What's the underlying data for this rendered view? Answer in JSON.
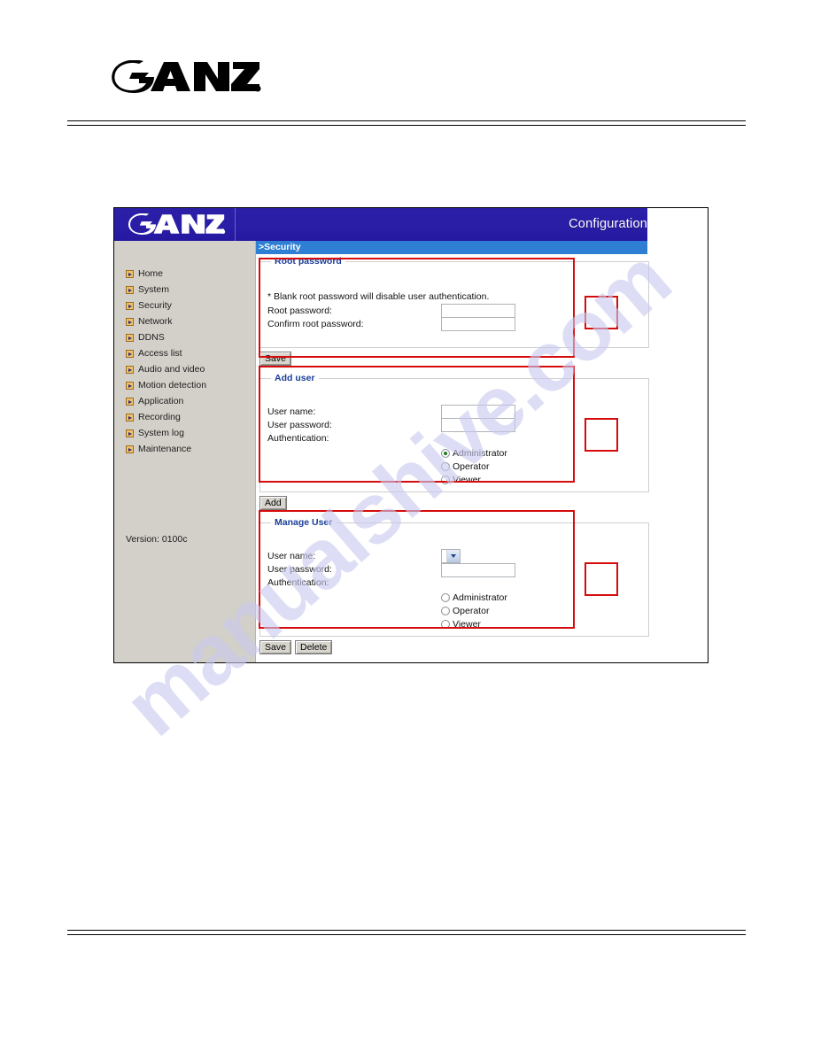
{
  "document": {
    "brand_logo": "ganz-logo",
    "watermark_text": "manualshive.com",
    "rule_top": "",
    "rule_bottom": ""
  },
  "ui": {
    "logo": "ganz-logo",
    "header_right_label": "Configuration",
    "breadcrumb": ">Security",
    "version_text": "Version: 0100c",
    "sidebar": {
      "items": [
        {
          "label": "Home",
          "icon": "arrow-bullet-icon"
        },
        {
          "label": "System",
          "icon": "arrow-bullet-icon"
        },
        {
          "label": "Security",
          "icon": "arrow-bullet-icon"
        },
        {
          "label": "Network",
          "icon": "arrow-bullet-icon"
        },
        {
          "label": "DDNS",
          "icon": "arrow-bullet-icon"
        },
        {
          "label": "Access list",
          "icon": "arrow-bullet-icon"
        },
        {
          "label": "Audio and video",
          "icon": "arrow-bullet-icon"
        },
        {
          "label": "Motion detection",
          "icon": "arrow-bullet-icon"
        },
        {
          "label": "Application",
          "icon": "arrow-bullet-icon"
        },
        {
          "label": "Recording",
          "icon": "arrow-bullet-icon"
        },
        {
          "label": "System log",
          "icon": "arrow-bullet-icon"
        },
        {
          "label": "Maintenance",
          "icon": "arrow-bullet-icon"
        }
      ]
    },
    "panels": {
      "root_password": {
        "legend": "Root password",
        "note": "* Blank root password will disable user authentication.",
        "label_password": "Root password:",
        "label_confirm": "Confirm root password:",
        "value_password": "",
        "value_confirm": "",
        "save_label": "Save"
      },
      "add_user": {
        "legend": "Add user",
        "label_user": "User name:",
        "label_password": "User password:",
        "label_auth": "Authentication:",
        "value_user": "",
        "value_password": "",
        "radios": [
          {
            "label": "Administrator",
            "checked": true
          },
          {
            "label": "Operator",
            "checked": false
          },
          {
            "label": "Viewer",
            "checked": false
          }
        ],
        "add_label": "Add"
      },
      "manage_user": {
        "legend": "Manage User",
        "label_user": "User name:",
        "label_password": "User password:",
        "label_auth": "Authentication:",
        "selected_user": "",
        "value_password": "",
        "radios": [
          {
            "label": "Administrator",
            "checked": false
          },
          {
            "label": "Operator",
            "checked": false
          },
          {
            "label": "Viewer",
            "checked": false
          }
        ],
        "save_label": "Save",
        "delete_label": "Delete"
      }
    },
    "colors": {
      "header_blue": "#2a1ea6",
      "breadcrumb_blue": "#2e7fd4",
      "sidebar_grey": "#d3d0c9",
      "legend_blue": "#1b3f97",
      "annotation_red": "#d60c0c",
      "bullet_orange": "#f0c070",
      "watermark_purple": "#c9c9ef"
    }
  }
}
